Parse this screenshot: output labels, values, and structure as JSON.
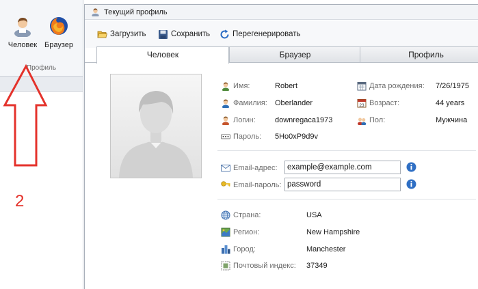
{
  "ribbon": {
    "buttons": [
      {
        "label": "Человек",
        "icon": "person-icon"
      },
      {
        "label": "Браузер",
        "icon": "firefox-icon"
      }
    ],
    "group_label": "Профиль"
  },
  "annotation": {
    "number": "2",
    "color": "#e4322b"
  },
  "window": {
    "title": "Текущий профиль",
    "toolbar": {
      "load_label": "Загрузить",
      "save_label": "Сохранить",
      "regenerate_label": "Перегенерировать"
    },
    "tabs": [
      {
        "label": "Человек",
        "active": true
      },
      {
        "label": "Браузер",
        "active": false
      },
      {
        "label": "Профиль",
        "active": false
      }
    ]
  },
  "person": {
    "first_name_label": "Имя:",
    "first_name": "Robert",
    "last_name_label": "Фамилия:",
    "last_name": "Oberlander",
    "login_label": "Логин:",
    "login": "downregaca1973",
    "password_label": "Пароль:",
    "password": "5Ho0xP9d9v",
    "birth_label": "Дата рождения:",
    "birth": "7/26/1975",
    "age_label": "Возраст:",
    "age": "44 years",
    "sex_label": "Пол:",
    "sex": "Мужчина"
  },
  "email": {
    "address_label": "Email-адрес:",
    "address_value": "example@example.com",
    "password_label": "Email-пароль:",
    "password_value": "password"
  },
  "location": {
    "country_label": "Страна:",
    "country": "USA",
    "region_label": "Регион:",
    "region": "New Hampshire",
    "city_label": "Город:",
    "city": "Manchester",
    "zip_label": "Почтовый индекс:",
    "zip": "37349"
  }
}
